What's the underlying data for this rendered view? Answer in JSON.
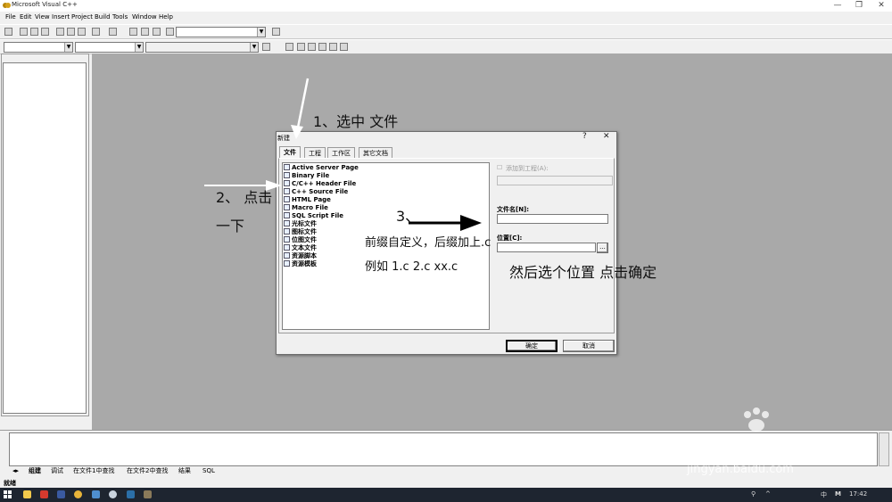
{
  "window": {
    "title": "Microsoft Visual C++",
    "controls": [
      "—",
      "❐",
      "✕"
    ]
  },
  "menu": [
    "File",
    "Edit",
    "View",
    "Insert",
    "Project",
    "Build",
    "Tools",
    "Window",
    "Help"
  ],
  "dialog": {
    "title": "新建",
    "help_icon": "?",
    "close_icon": "✕",
    "tabs": [
      "文件",
      "工程",
      "工作区",
      "其它文档"
    ],
    "active_tab": "文件",
    "file_types": [
      "Active Server Page",
      "Binary File",
      "C/C++ Header File",
      "C++ Source File",
      "HTML Page",
      "Macro File",
      "SQL Script File",
      "光标文件",
      "图标文件",
      "位图文件",
      "文本文件",
      "资源脚本",
      "资源模板"
    ],
    "add_to_project_label": "添加到工程(A):",
    "filename_label": "文件名[N]:",
    "filename_value": "",
    "location_label": "位置[C]:",
    "location_value": "",
    "browse_label": "...",
    "ok_label": "确定",
    "cancel_label": "取消"
  },
  "output_tabs": [
    "组建",
    "调试",
    "在文件1中查找",
    "在文件2中查找",
    "结果",
    "SQL"
  ],
  "status_text": "就绪",
  "taskbar": {
    "clock": "17:42",
    "ime": "中",
    "tray_M": "M"
  },
  "annotations": {
    "step1": "1、选中 文件",
    "step2_a": "2、 点击",
    "step2_b": "一下",
    "step3": "3、",
    "note_a": "前缀自定义，后缀加上.c",
    "note_b": "例如 1.c  2.c  xx.c",
    "note_c": "然后选个位置 点击确定"
  },
  "watermark": {
    "brand": "Bai 经验",
    "url": "jingyan.baidu.com"
  }
}
